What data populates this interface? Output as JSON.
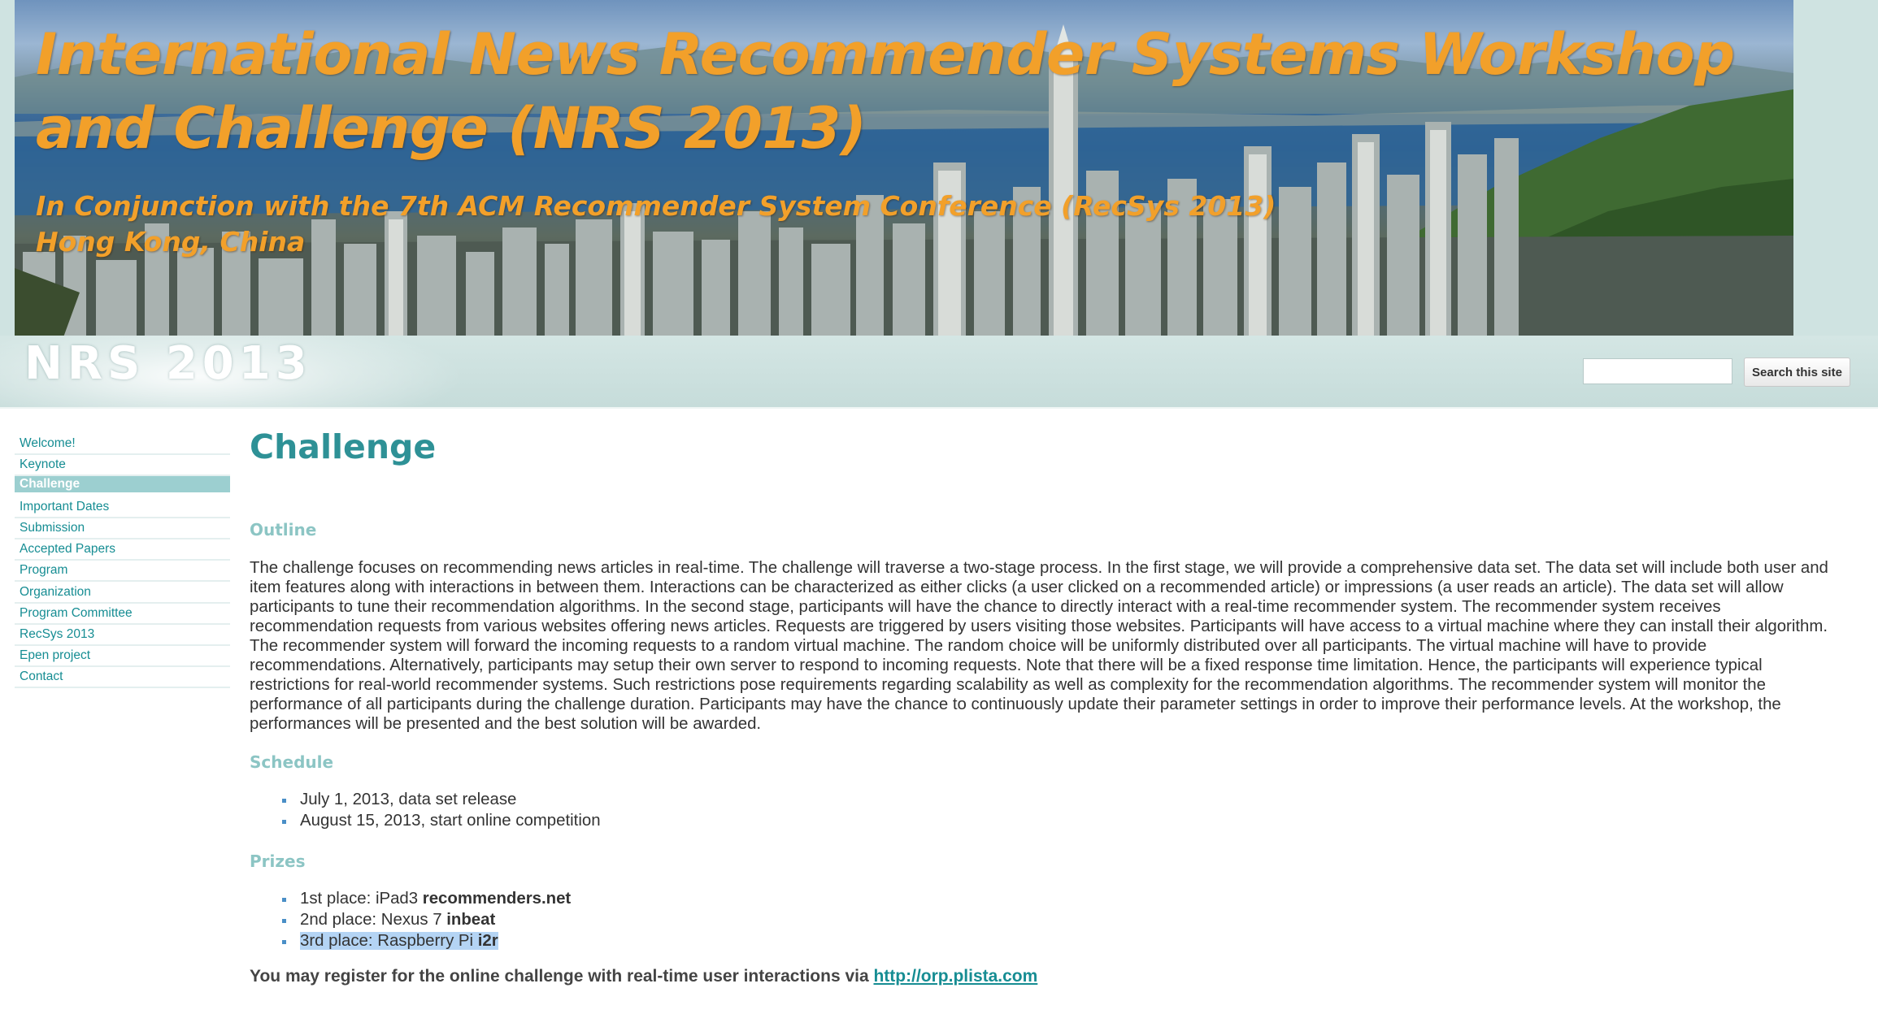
{
  "banner": {
    "title_line1": "International News Recommender Systems Workshop",
    "title_line2": "and Challenge (NRS 2013)",
    "subtitle_line1": "In Conjunction with the 7th ACM Recommender System Conference (RecSys 2013)",
    "subtitle_line2": "Hong Kong, China"
  },
  "header": {
    "site_name": "NRS 2013",
    "search_value": "",
    "search_button_label": "Search this site"
  },
  "sidebar": {
    "items": [
      {
        "label": "Welcome!",
        "active": false
      },
      {
        "label": "Keynote",
        "active": false
      },
      {
        "label": "Challenge",
        "active": true
      },
      {
        "label": "Important Dates",
        "active": false
      },
      {
        "label": "Submission",
        "active": false
      },
      {
        "label": "Accepted Papers",
        "active": false
      },
      {
        "label": "Program",
        "active": false
      },
      {
        "label": "Organization",
        "active": false
      },
      {
        "label": "Program Committee",
        "active": false
      },
      {
        "label": "RecSys 2013",
        "active": false
      },
      {
        "label": "Epen project",
        "active": false
      },
      {
        "label": "Contact",
        "active": false
      }
    ]
  },
  "main": {
    "page_title": "Challenge",
    "outline_heading": "Outline",
    "outline_text": "The challenge focuses on recommending news articles in real-time. The challenge will traverse a two-stage process. In the first stage, we will provide a comprehensive data set. The data set will include both user and item features along with interactions in between them. Interactions can be characterized as either clicks (a user clicked on a recommended article) or impressions (a user reads an article). The data set will allow participants to tune their recommendation algorithms. In the second stage, participants will have the chance to directly interact with a real-time recommender system. The recommender system receives recommendation requests from various websites offering news articles. Requests are triggered by users visiting those websites. Participants will have access to a virtual machine where they can install their algorithm. The recommender system will forward the incoming requests to a random virtual machine. The random choice will be uniformly distributed over all participants. The virtual machine will have to provide recommendations. Alternatively, participants may setup their own server to respond to incoming requests. Note that there will be a fixed response time limitation. Hence, the participants will experience typical restrictions for real-world recommender systems. Such restrictions pose requirements regarding scalability as well as complexity for the recommendation algorithms. The recommender system will monitor the performance of all participants during the challenge duration. Participants may have the chance to continuously update their parameter settings in order to improve their performance levels. At the workshop, the performances will be presented and the best solution will be awarded.",
    "schedule_heading": "Schedule",
    "schedule": [
      "July 1, 2013, data set release",
      "August 15, 2013, start online competition"
    ],
    "prizes_heading": "Prizes",
    "prizes": [
      {
        "text": "1st place: iPad3 ",
        "winner": "recommenders.net"
      },
      {
        "text": "2nd place: Nexus 7 ",
        "winner": "inbeat"
      },
      {
        "text": "3rd place: Raspberry Pi ",
        "winner": "i2r"
      }
    ],
    "register_text": "You may register for the online challenge with real-time user interactions via ",
    "register_link": "http://orp.plista.com"
  },
  "colors": {
    "accent": "#2e9196",
    "link": "#168d93",
    "banner_text": "#f2a02a",
    "nav_active_bg": "#9ccfd0",
    "header_bg": "#cfe3e1",
    "selection": "#b4d4f4"
  }
}
